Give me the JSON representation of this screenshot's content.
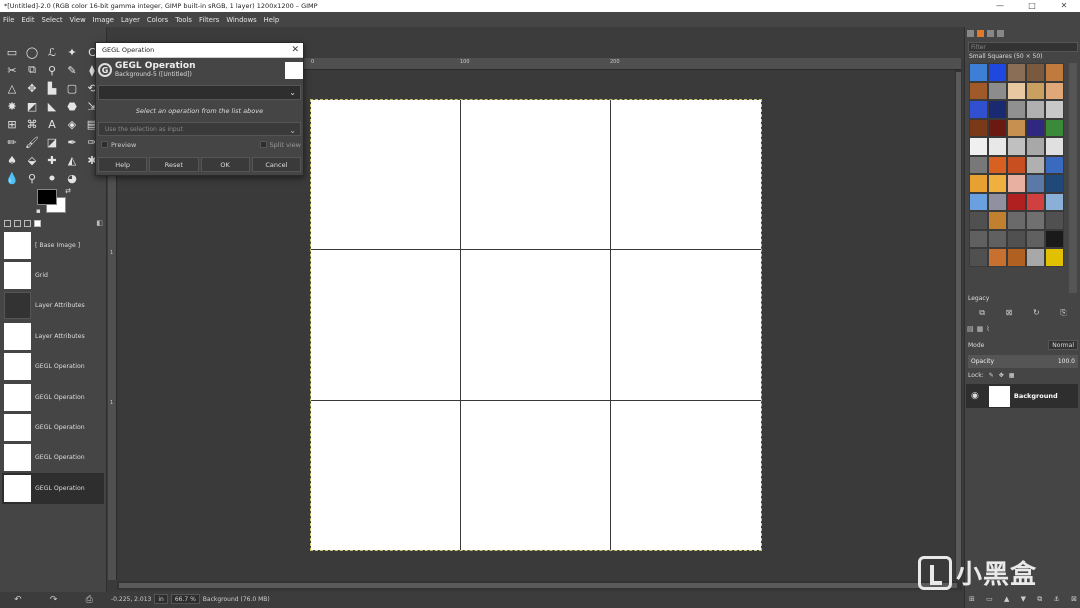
{
  "window": {
    "title": "*[Untitled]-2.0 (RGB color 16-bit gamma integer, GIMP built-in sRGB, 1 layer) 1200x1200 – GIMP",
    "controls": [
      "—",
      "□",
      "✕"
    ]
  },
  "menubar": [
    "File",
    "Edit",
    "Select",
    "View",
    "Image",
    "Layer",
    "Colors",
    "Tools",
    "Filters",
    "Windows",
    "Help"
  ],
  "toolbox": {
    "tools": [
      {
        "icon": "rect-select-icon",
        "glyph": "▭"
      },
      {
        "icon": "ellipse-select-icon",
        "glyph": "◯"
      },
      {
        "icon": "free-select-icon",
        "glyph": "ℒ"
      },
      {
        "icon": "fuzzy-select-icon",
        "glyph": "✦"
      },
      {
        "icon": "color-select-icon",
        "glyph": "C"
      },
      {
        "icon": "crop-icon",
        "glyph": "✂"
      },
      {
        "icon": "scissors-icon",
        "glyph": "⧉"
      },
      {
        "icon": "foreground-select-icon",
        "glyph": "⚲"
      },
      {
        "icon": "paths-icon",
        "glyph": "✎"
      },
      {
        "icon": "color-picker-icon",
        "glyph": "⧫"
      },
      {
        "icon": "zoom-icon",
        "glyph": "△"
      },
      {
        "icon": "move-icon",
        "glyph": "✥"
      },
      {
        "icon": "align-icon",
        "glyph": "▙"
      },
      {
        "icon": "transform-icon",
        "glyph": "▢"
      },
      {
        "icon": "rotate-icon",
        "glyph": "⟲"
      },
      {
        "icon": "warp-icon",
        "glyph": "✸"
      },
      {
        "icon": "flip-icon",
        "glyph": "◩"
      },
      {
        "icon": "perspective-icon",
        "glyph": "◣"
      },
      {
        "icon": "cage-icon",
        "glyph": "⬣"
      },
      {
        "icon": "scale-icon",
        "glyph": "⇲"
      },
      {
        "icon": "unified-transform-icon",
        "glyph": "⊞"
      },
      {
        "icon": "handle-transform-icon",
        "glyph": "⌘"
      },
      {
        "icon": "text-icon",
        "glyph": "A"
      },
      {
        "icon": "bucket-fill-icon",
        "glyph": "◈"
      },
      {
        "icon": "gradient-icon",
        "glyph": "▤"
      },
      {
        "icon": "pencil-icon",
        "glyph": "✏"
      },
      {
        "icon": "paintbrush-icon",
        "glyph": "🖌"
      },
      {
        "icon": "eraser-icon",
        "glyph": "◪"
      },
      {
        "icon": "airbrush-icon",
        "glyph": "✒"
      },
      {
        "icon": "ink-icon",
        "glyph": "✑"
      },
      {
        "icon": "mypaint-brush-icon",
        "glyph": "♠"
      },
      {
        "icon": "clone-icon",
        "glyph": "⬙"
      },
      {
        "icon": "heal-icon",
        "glyph": "✚"
      },
      {
        "icon": "perspective-clone-icon",
        "glyph": "◭"
      },
      {
        "icon": "blur-icon",
        "glyph": "✱"
      },
      {
        "icon": "dodge-burn-icon",
        "glyph": "💧"
      },
      {
        "icon": "smudge-icon",
        "glyph": "⚲"
      },
      {
        "icon": "measure-icon",
        "glyph": "⚫"
      },
      {
        "icon": "warp-transform-icon",
        "glyph": "◕"
      }
    ],
    "undo_history": [
      {
        "label": "[ Base Image ]",
        "dark": false
      },
      {
        "label": "Grid",
        "dark": false
      },
      {
        "label": "Layer Attributes",
        "dark": true
      },
      {
        "label": "Layer Attributes",
        "dark": false
      },
      {
        "label": "GEGL Operation",
        "dark": false
      },
      {
        "label": "GEGL Operation",
        "dark": false
      },
      {
        "label": "GEGL Operation",
        "dark": false
      },
      {
        "label": "GEGL Operation",
        "dark": false
      },
      {
        "label": "GEGL Operation",
        "dark": false,
        "selected": true
      }
    ]
  },
  "rulers": {
    "h": [
      "0",
      "100",
      "200"
    ],
    "v": [
      "1",
      "1"
    ]
  },
  "statusbar": {
    "coords": "-0.225, 2.013",
    "unit": "in",
    "zoom": "66.7 %",
    "info": "Background (76.0 MB)"
  },
  "gegl_dialog": {
    "window_title": "GEGL Operation",
    "header_title": "GEGL Operation",
    "header_subtitle": "Background-5 ([Untitled])",
    "hint": "Select an operation from the list above",
    "input_placeholder": "Use the selection as input",
    "preview_label": "Preview",
    "split_label": "Split view",
    "buttons": {
      "help": "Help",
      "reset": "Reset",
      "ok": "OK",
      "cancel": "Cancel"
    }
  },
  "patterns_panel": {
    "filter_placeholder": "Filter",
    "label": "Small Squares (50 × 50)",
    "preset": "Legacy",
    "colors": [
      "#3d7fd6",
      "#1f48e0",
      "#8a6e55",
      "#7a5a3e",
      "#c07a3e",
      "#a05a2a",
      "#8c8c8c",
      "#e8c8a0",
      "#c9a060",
      "#e0a878",
      "#3050d0",
      "#1a2a70",
      "#909090",
      "#b0b0b0",
      "#c8c8c8",
      "#7a3a1a",
      "#6a1a10",
      "#c89050",
      "#302880",
      "#3a8a3a",
      "#f0f0f0",
      "#e8e8e8",
      "#c0c0c0",
      "#a8a8a8",
      "#e0e0e0",
      "#787878",
      "#d86020",
      "#c85020",
      "#b0b0b0",
      "#3a6ac0",
      "#e8a030",
      "#f0b040",
      "#e8b0a0",
      "#5a78a8",
      "#204878",
      "#6aa0e0",
      "#9090a0",
      "#b02020",
      "#d04040",
      "#8ab0d8",
      "#505050",
      "#c08030",
      "#6a6a6a",
      "#707070",
      "#505050",
      "#606060",
      "#606060",
      "#505050",
      "#606060",
      "#1a1a1a",
      "#505050",
      "#c87030",
      "#b06020",
      "#a8a8a8",
      "#e0c000"
    ]
  },
  "layers_panel": {
    "mode_label": "Mode",
    "mode_value": "Normal",
    "opacity_label": "Opacity",
    "opacity_value": "100.0",
    "lock_label": "Lock:",
    "layer_name": "Background"
  },
  "watermark": "小黑盒"
}
